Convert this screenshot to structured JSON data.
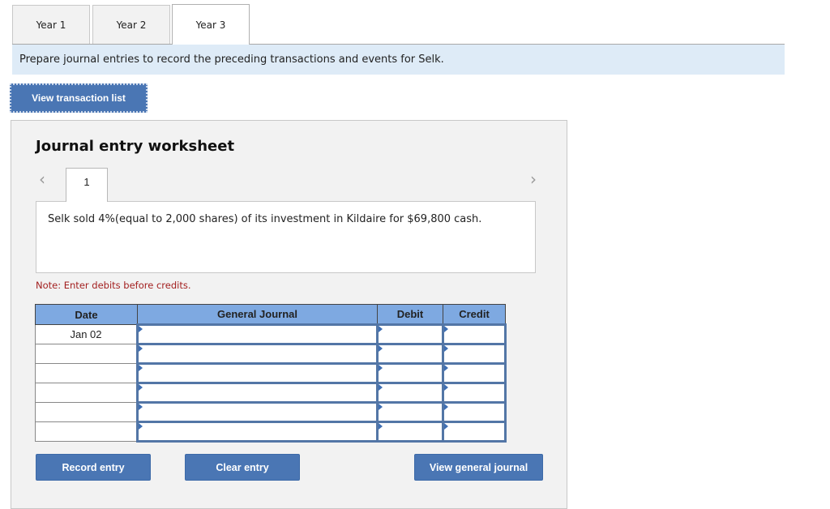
{
  "year_tabs": [
    {
      "label": "Year 1",
      "active": false
    },
    {
      "label": "Year 2",
      "active": false
    },
    {
      "label": "Year 3",
      "active": true
    }
  ],
  "instruction": "Prepare journal entries to record the preceding transactions and events for Selk.",
  "view_transaction_list_label": "View transaction list",
  "worksheet": {
    "title": "Journal entry worksheet",
    "prev_icon": "chevron-left-icon",
    "next_icon": "chevron-right-icon",
    "entry_tab": "1",
    "description": "Selk sold 4%(equal to 2,000 shares) of its investment in Kildaire for $69,800 cash.",
    "note": "Note: Enter debits before credits.",
    "table": {
      "headers": [
        "Date",
        "General Journal",
        "Debit",
        "Credit"
      ],
      "rows": [
        {
          "date": "Jan 02",
          "account": "",
          "debit": "",
          "credit": ""
        },
        {
          "date": "",
          "account": "",
          "debit": "",
          "credit": ""
        },
        {
          "date": "",
          "account": "",
          "debit": "",
          "credit": ""
        },
        {
          "date": "",
          "account": "",
          "debit": "",
          "credit": ""
        },
        {
          "date": "",
          "account": "",
          "debit": "",
          "credit": ""
        },
        {
          "date": "",
          "account": "",
          "debit": "",
          "credit": ""
        }
      ]
    },
    "buttons": {
      "record": "Record entry",
      "clear": "Clear entry",
      "view_general_journal": "View general journal"
    }
  },
  "colors": {
    "button_blue": "#4a76b4",
    "header_blue": "#7ea9e1",
    "instruction_bg": "#deebf7",
    "note_red": "#a32020"
  }
}
